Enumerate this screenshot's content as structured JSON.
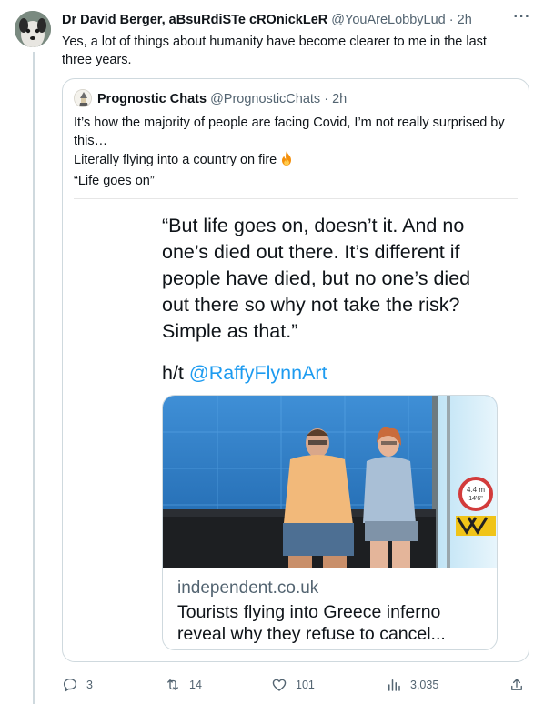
{
  "tweet": {
    "author_name": "Dr David Berger, aBsuRdiSTe cROnickLeR",
    "author_handle": "@YouAreLobbyLud",
    "separator": "·",
    "time": "2h",
    "more_label": "···",
    "text": "Yes, a lot of things about humanity have become clearer to me in the last three years."
  },
  "quoted": {
    "author_name": "Prognostic Chats",
    "author_handle": "@PrognosticChats",
    "separator": "·",
    "time": "2h",
    "lines": [
      "It’s how the majority of people are facing Covid, I’m not really surprised by this…",
      "Literally flying into a country on fire",
      "“Life goes on”"
    ],
    "media": {
      "quote": "“But life goes on, doesn’t it. And no one’s died out there. It’s different if people have died, but no one’s died out there so why not take the risk? Simple as that.”",
      "ht_prefix": "h/t ",
      "ht_mention": "@RaffyFlynnArt",
      "card": {
        "domain": "independent.co.uk",
        "title": "Tourists flying into Greece inferno reveal why they refuse to cancel...",
        "sign_line1": "4.4 m",
        "sign_line2": "14'6\""
      }
    }
  },
  "actions": {
    "replies": "3",
    "retweets": "14",
    "likes": "101",
    "views": "3,035"
  },
  "icons": {
    "reply": "reply-icon",
    "retweet": "retweet-icon",
    "like": "heart-icon",
    "views": "views-icon",
    "share": "share-icon",
    "fire": "fire-icon"
  },
  "colors": {
    "link": "#1d9bf0",
    "muted": "#536471",
    "border": "#cfd9de"
  }
}
